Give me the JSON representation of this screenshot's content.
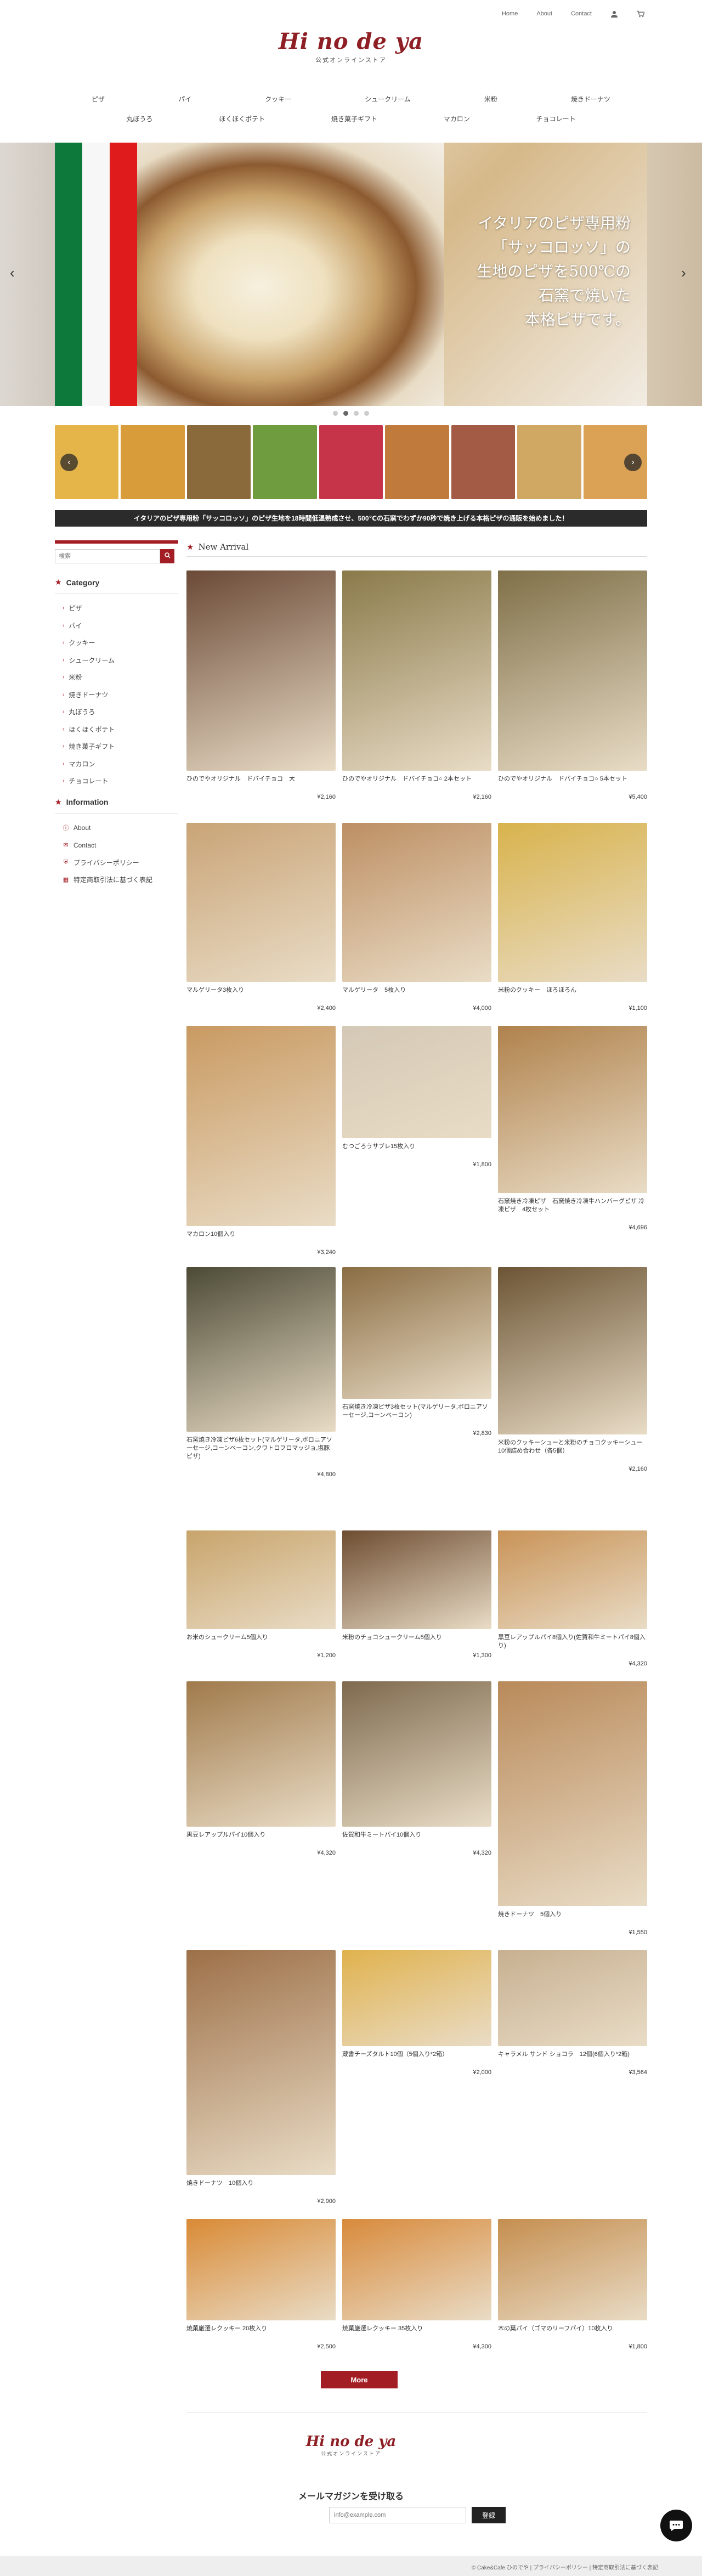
{
  "header": {
    "top_links": [
      "Home",
      "About",
      "Contact"
    ],
    "icons": [
      "person-icon",
      "cart-icon"
    ],
    "logo_script": "Hi no de ya",
    "logo_sub": "公式オンラインストア"
  },
  "categories_row1": [
    "ピザ",
    "パイ",
    "クッキー",
    "シュークリーム",
    "米粉",
    "焼きドーナツ"
  ],
  "categories_row2": [
    "丸ぼうろ",
    "ほくほくポテト",
    "焼き菓子ギフト",
    "マカロン",
    "チョコレート"
  ],
  "hero": {
    "copy_lines": [
      "イタリアのピザ専用粉",
      "「サッコロッソ」の",
      "生地のピザを500℃の",
      "石窯で焼いた",
      "本格ピザです。"
    ],
    "dots": 4,
    "active_dot": 1
  },
  "strip": {
    "thumb_colors": [
      "#e5b54a",
      "#d89c3a",
      "#8a6a3b",
      "#6f9c3f",
      "#c6344a",
      "#c07a3c",
      "#a35b45",
      "#d0a864",
      "#dba154"
    ]
  },
  "banner_text": "イタリアのピザ専用粉「サッコロッソ」のピザ生地を18時間低温熟成させ、500℃の石窯でわずか90秒で焼き上げる本格ピザの通販を始めました！",
  "sidebar": {
    "search_placeholder": "検索",
    "category_title": "Category",
    "categories": [
      "ピザ",
      "パイ",
      "クッキー",
      "シュークリーム",
      "米粉",
      "焼きドーナツ",
      "丸ぼうろ",
      "ほくほくポテト",
      "焼き菓子ギフト",
      "マカロン",
      "チョコレート"
    ],
    "info_title": "Information",
    "info_items": [
      "About",
      "Contact",
      "プライバシーポリシー",
      "特定商取引法に基づく表記"
    ]
  },
  "main": {
    "section_title": "New Arrival",
    "products": [
      {
        "name": "ひのでやオリジナル　ドバイチョコ　大",
        "price": "¥2,160",
        "color": "#6b4a37"
      },
      {
        "name": "ひのでやオリジナル　ドバイチョコ○ 2本セット",
        "price": "¥2,160",
        "color": "#8a7a4a"
      },
      {
        "name": "ひのでやオリジナル　ドバイチョコ○ 5本セット",
        "price": "¥5,400",
        "color": "#7f7048"
      },
      {
        "name": "マルゲリータ3枚入り",
        "price": "¥2,400",
        "color": "#c9a477"
      },
      {
        "name": "マルゲリータ　5枚入り",
        "price": "¥4,000",
        "color": "#bd8f63"
      },
      {
        "name": "米粉のクッキー　ほろほろん",
        "price": "¥1,100",
        "color": "#d8b34c"
      },
      {
        "name": "マカロン10個入り",
        "price": "¥3,240",
        "color": "#c99a62"
      },
      {
        "name": "むつごろうサブレ15枚入り",
        "price": "¥1,800",
        "color": "#d4c9b6"
      },
      {
        "name": "石窯焼き冷凍ピザ　石窯焼き冷凍牛ハンバーグピザ 冷凍ピザ　4枚セット",
        "price": "¥4,696",
        "color": "#b0824c"
      },
      {
        "name": "石窯焼き冷凍ピザ6枚セット(マルゲリータ,ボロニアソーセージ,コーンベーコン,クワトロフロマッジョ,塩豚ピザ)",
        "price": "¥4,800",
        "color": "#4c4a35"
      },
      {
        "name": "石窯焼き冷凍ピザ3枚セット(マルゲリータ,ボロニアソーセージ,コーンベーコン)",
        "price": "¥2,830",
        "color": "#8a6d43"
      },
      {
        "name": "米粉のクッキーシューと米粉のチョコクッキーシュー10個詰め合わせ（各5個）",
        "price": "¥2,160",
        "color": "#6c5535"
      },
      {
        "name": "お米のシュークリーム5個入り",
        "price": "¥1,200",
        "color": "#c8a46b"
      },
      {
        "name": "米粉のチョコシュークリーム5個入り",
        "price": "¥1,300",
        "color": "#6e4d32"
      },
      {
        "name": "黒豆レアップルパイ8個入り(佐賀和牛ミートパイ8個入り)",
        "price": "¥4,320",
        "color": "#c99357"
      },
      {
        "name": "黒豆レアップルパイ10個入り",
        "price": "¥4,320",
        "color": "#a07a4b"
      },
      {
        "name": "佐賀和牛ミートパイ10個入り",
        "price": "¥4,320",
        "color": "#7e6a4e"
      },
      {
        "name": "焼きドーナツ　5個入り",
        "price": "¥1,550",
        "color": "#b98a5a"
      },
      {
        "name": "焼きドーナツ　10個入り",
        "price": "¥2,900",
        "color": "#9d7048"
      },
      {
        "name": "蔵書チーズタルト10個（5個入り*2箱）",
        "price": "¥2,000",
        "color": "#e0b24e"
      },
      {
        "name": "キャラメル サンド ショコラ　12個(6個入り*2箱)",
        "price": "¥3,564",
        "color": "#c7b091"
      },
      {
        "name": "焼菓厳選レクッキー 20枚入り",
        "price": "¥2,500",
        "color": "#d98a35"
      },
      {
        "name": "焼菓厳選レクッキー 35枚入り",
        "price": "¥4,300",
        "color": "#d88a3b"
      },
      {
        "name": "木の葉パイ（ゴマのリーフパイ）10枚入り",
        "price": "¥1,800",
        "color": "#c58e4f"
      }
    ],
    "more_label": "More"
  },
  "footer": {
    "logo_script": "Hi no de ya",
    "logo_sub": "公式オンラインストア",
    "mail_title": "メールマガジンを受け取る",
    "mail_placeholder": "info@example.com",
    "mail_button": "登録",
    "copyright": "© Cake&Cafe ひのでや | プライバシーポリシー | 特定商取引法に基づく表記"
  }
}
